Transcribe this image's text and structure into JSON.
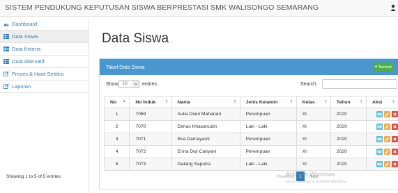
{
  "app": {
    "title": "SISTEM PENDUKUNG KEPUTUSAN SISWA BERPRESTASI SMK WALISONGO SEMARANG"
  },
  "sidebar": {
    "items": [
      {
        "label": "Dashboard",
        "icon": "dashboard-icon",
        "active": false
      },
      {
        "label": "Data Siswa",
        "icon": "table-icon",
        "active": true
      },
      {
        "label": "Data Kriteria",
        "icon": "table-icon",
        "active": false
      },
      {
        "label": "Data Alternatif",
        "icon": "table-icon",
        "active": false
      },
      {
        "label": "Proses & Hasil Seleksi",
        "icon": "edit-icon",
        "active": false
      },
      {
        "label": "Laporan",
        "icon": "edit-icon",
        "active": false
      }
    ]
  },
  "page": {
    "title": "Data Siswa"
  },
  "panel": {
    "title": "Tabel Data Siswa",
    "add_button": "Tambah",
    "show_label": "Show",
    "page_size": "10",
    "entries_label": "entries",
    "search_label": "Search:",
    "search_value": ""
  },
  "table": {
    "headers": [
      "No",
      "No Induk",
      "Nama",
      "Jenis Kelamin",
      "Kelas",
      "Tahun",
      "Aksi"
    ],
    "rows": [
      {
        "no": "1",
        "induk": "7069",
        "nama": "Aulia Diani Maharani",
        "jk": "Perempuan",
        "kelas": "XI",
        "tahun": "2020"
      },
      {
        "no": "2",
        "induk": "7070",
        "nama": "Dimas Khasanudin",
        "jk": "Laki - Laki",
        "kelas": "XI",
        "tahun": "2020"
      },
      {
        "no": "3",
        "induk": "7071",
        "nama": "Eka Damayanti",
        "jk": "Perempuan",
        "kelas": "XI",
        "tahun": "2020"
      },
      {
        "no": "4",
        "induk": "7072",
        "nama": "Erina Dwi Cahyani",
        "jk": "Perempuan",
        "kelas": "XI",
        "tahun": "2020"
      },
      {
        "no": "5",
        "induk": "7073",
        "nama": "Galang Saputra",
        "jk": "Laki - Laki",
        "kelas": "XI",
        "tahun": "2020"
      }
    ]
  },
  "footer": {
    "info": "Showing 1 to 5 of 5 entries",
    "previous": "Previous",
    "current_page": "1",
    "next": "Next"
  },
  "watermark": {
    "title": "Activate Windows",
    "subtitle": "Go to Settings to activate Windows."
  },
  "colors": {
    "panel_header": "#4a96cf",
    "add_button": "#4cae4c",
    "view": "#5bc0de",
    "edit": "#f0ad4e",
    "delete": "#d9534f",
    "link": "#337ab7"
  }
}
